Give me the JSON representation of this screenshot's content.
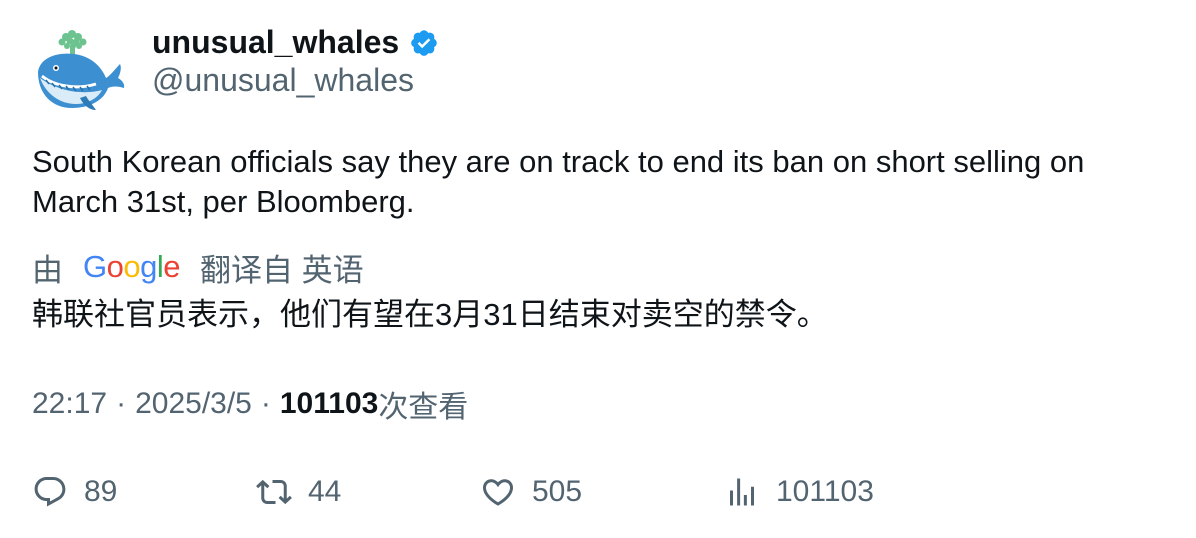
{
  "author": {
    "display_name": "unusual_whales",
    "handle": "@unusual_whales",
    "verified": true,
    "avatar_icon": "whale-avatar-icon"
  },
  "tweet": {
    "text": "South Korean officials say they are on track to end its ban on short selling on March 31st, per Bloomberg."
  },
  "translation": {
    "prefix": "由",
    "provider": "Google",
    "suffix": "翻译自 英语",
    "text": "韩联社官员表示，他们有望在3月31日结束对卖空的禁令。"
  },
  "meta": {
    "time": "22:17",
    "date": "2025/3/5",
    "views_count": "101103",
    "views_label": "次查看"
  },
  "actions": {
    "replies": "89",
    "retweets": "44",
    "likes": "505",
    "views": "101103"
  },
  "colors": {
    "verified_blue": "#1d9bf0",
    "secondary_text": "#536471",
    "primary_text": "#0f1419"
  }
}
